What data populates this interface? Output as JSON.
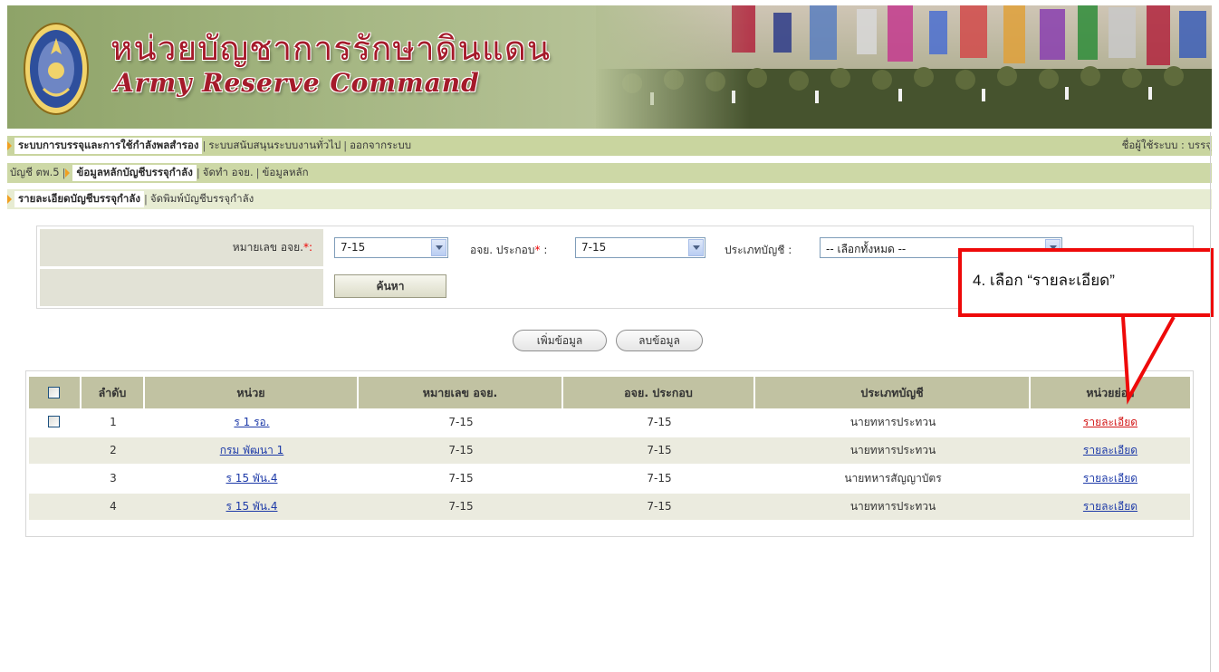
{
  "header": {
    "title_th": "หน่วยบัญชาการรักษาดินแดน",
    "title_en": "Army Reserve Command"
  },
  "menu1": {
    "items": [
      "ระบบการบรรจุและการใช้กำลังพลสำรอง",
      "ระบบสนับสนุนระบบงานทั่วไป",
      "ออกจากระบบ"
    ],
    "user_label": "ชื่อผู้ใช้ระบบ :",
    "user_name": "บรรจุ"
  },
  "menu2": {
    "items": [
      "บัญชี ตพ.5",
      "ข้อมูลหลักบัญชีบรรจุกำลัง",
      "จัดทำ อจย.",
      "ข้อมูลหลัก"
    ]
  },
  "menu3": {
    "items": [
      "รายละเอียดบัญชีบรรจุกำลัง",
      "จัดพิมพ์บัญชีบรรจุกำลัง"
    ]
  },
  "form": {
    "field1_label": "หมายเลข อจย.",
    "field1_value": "7-15",
    "field2_label": "อจย. ประกอบ",
    "field2_value": "7-15",
    "field3_label": "ประเภทบัญชี :",
    "field3_value": "-- เลือกทั้งหมด --",
    "required_mark": "*",
    "colon": ":",
    "search_label": "ค้นหา"
  },
  "actions": {
    "add_label": "เพิ่มข้อมูล",
    "delete_label": "ลบข้อมูล"
  },
  "table": {
    "headers": [
      "ลำดับ",
      "หน่วย",
      "หมายเลข อจย.",
      "อจย. ประกอบ",
      "ประเภทบัญชี",
      "หน่วยย่อย"
    ],
    "rows": [
      {
        "no": "1",
        "unit": "ร 1 รอ.",
        "ajy": "7-15",
        "ajy_comp": "7-15",
        "type": "นายทหารประทวน",
        "sub": "รายละเอียด"
      },
      {
        "no": "2",
        "unit": "กรม พัฒนา 1",
        "ajy": "7-15",
        "ajy_comp": "7-15",
        "type": "นายทหารประทวน",
        "sub": "รายละเอียด"
      },
      {
        "no": "3",
        "unit": "ร 15 พัน.4",
        "ajy": "7-15",
        "ajy_comp": "7-15",
        "type": "นายทหารสัญญาบัตร",
        "sub": "รายละเอียด"
      },
      {
        "no": "4",
        "unit": "ร 15 พัน.4",
        "ajy": "7-15",
        "ajy_comp": "7-15",
        "type": "นายทหารประทวน",
        "sub": "รายละเอียด"
      }
    ]
  },
  "callout": {
    "text": "4. เลือก “รายละเอียด”"
  },
  "colors": {
    "header_bg": "#c1c2a2",
    "alt_row": "#ebebdf",
    "link": "#1d3aa8",
    "highlight": "#ee0a0a"
  }
}
